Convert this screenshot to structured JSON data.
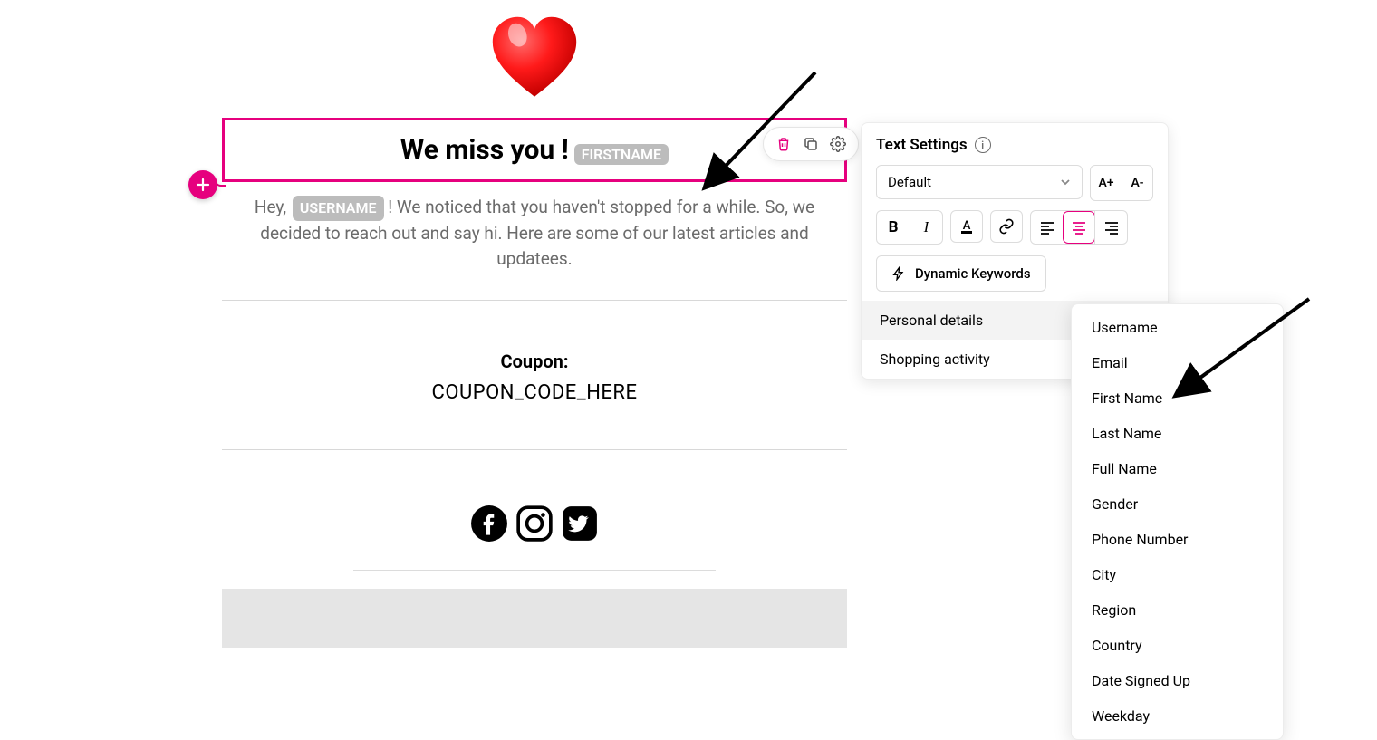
{
  "heading": {
    "text": "We miss you !",
    "token": "FIRSTNAME"
  },
  "body": {
    "prefix": "Hey, ",
    "token": "USERNAME",
    "rest": " ! We noticed that you haven't stopped for a while. So, we decided to reach out and say hi. Here are some of our latest articles and updatees."
  },
  "coupon": {
    "label": "Coupon:",
    "code": "COUPON_CODE_HERE"
  },
  "settings": {
    "title": "Text Settings",
    "font_default": "Default",
    "size_up": "A+",
    "size_down": "A-",
    "bold": "B",
    "italic": "I",
    "dynamic_label": "Dynamic Keywords",
    "categories": [
      {
        "label": "Personal details",
        "active": true
      },
      {
        "label": "Shopping activity",
        "active": false
      }
    ]
  },
  "keywords": [
    "Username",
    "Email",
    "First Name",
    "Last Name",
    "Full Name",
    "Gender",
    "Phone Number",
    "City",
    "Region",
    "Country",
    "Date Signed Up",
    "Weekday"
  ]
}
